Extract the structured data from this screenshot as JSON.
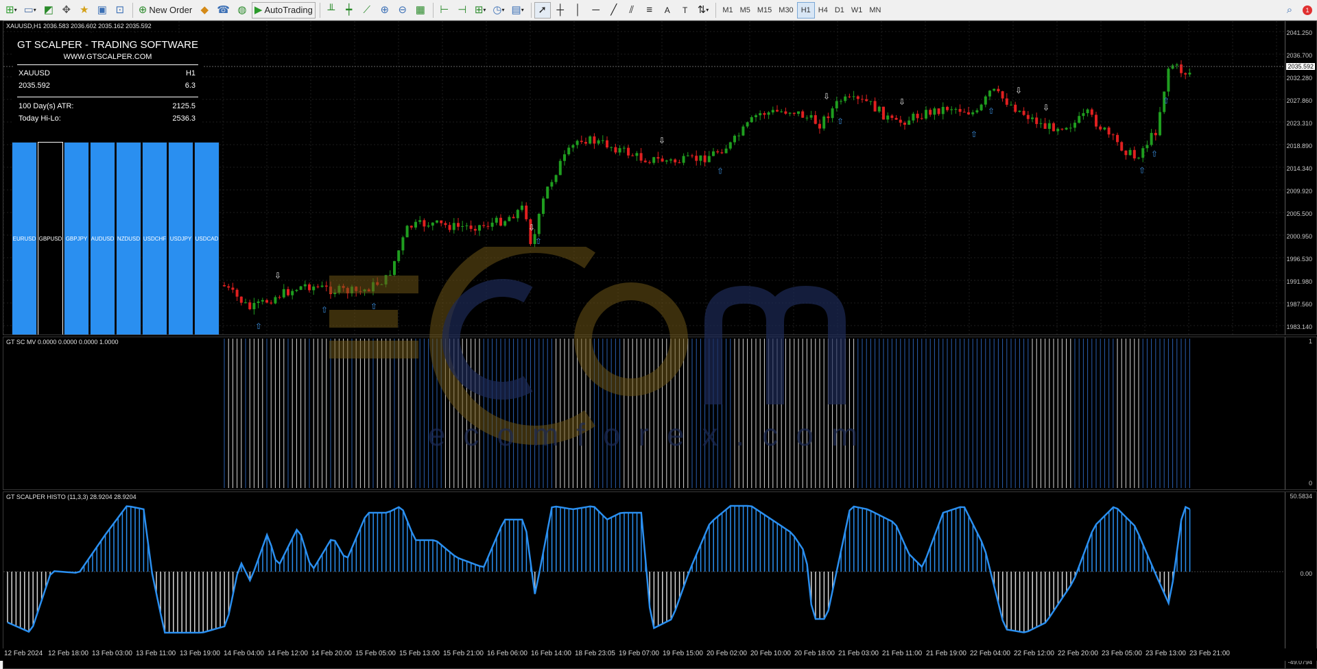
{
  "toolbar": {
    "new_order_label": "New Order",
    "autotrading_label": "AutoTrading",
    "timeframes": [
      "M1",
      "M5",
      "M15",
      "M30",
      "H1",
      "H4",
      "D1",
      "W1",
      "MN"
    ],
    "active_timeframe": "H1",
    "notification_count": "1"
  },
  "chart": {
    "header": "XAUUSD,H1  2036.583 2036.602 2035.162 2035.592",
    "current_price": "2035.592",
    "price_labels": [
      "2041.250",
      "2036.700",
      "2032.280",
      "2027.860",
      "2023.310",
      "2018.890",
      "2014.340",
      "2009.920",
      "2005.500",
      "2000.950",
      "1996.530",
      "1991.980",
      "1987.560",
      "1983.140"
    ],
    "bull_color": "#1f9d1f",
    "bear_color": "#e02020"
  },
  "info_panel": {
    "title": "GT SCALPER - TRADING SOFTWARE",
    "website": "WWW.GTSCALPER.COM",
    "symbol": "XAUUSD",
    "timeframe": "H1",
    "price": "2035.592",
    "spread": "6.3",
    "atr_label": "100 Day(s) ATR:",
    "atr_value": "2125.5",
    "hilo_label": "Today Hi-Lo:",
    "hilo_value": "2536.3"
  },
  "currency_buttons": [
    {
      "label": "EURUSD",
      "selected": false
    },
    {
      "label": "GBPUSD",
      "selected": true
    },
    {
      "label": "GBPJPY",
      "selected": false
    },
    {
      "label": "AUDUSD",
      "selected": false
    },
    {
      "label": "NZDUSD",
      "selected": false
    },
    {
      "label": "USDCHF",
      "selected": false
    },
    {
      "label": "USDJPY",
      "selected": false
    },
    {
      "label": "USDCAD",
      "selected": false
    }
  ],
  "indicator_mv": {
    "title": "GT SC MV 0.0000 0.0000 0.0000 1.0000",
    "axis_top": "1",
    "axis_bottom": "0"
  },
  "indicator_histo": {
    "title": "GT SCALPER HISTO (11,3,3) 28.9204 28.9204",
    "axis_top": "50.5834",
    "axis_mid": "0.00",
    "axis_bottom": "-49.0794"
  },
  "time_axis": [
    "12 Feb 2024",
    "12 Feb 18:00",
    "13 Feb 03:00",
    "13 Feb 11:00",
    "13 Feb 19:00",
    "14 Feb 04:00",
    "14 Feb 12:00",
    "14 Feb 20:00",
    "15 Feb 05:00",
    "15 Feb 13:00",
    "15 Feb 21:00",
    "16 Feb 06:00",
    "16 Feb 14:00",
    "18 Feb 23:05",
    "19 Feb 07:00",
    "19 Feb 15:00",
    "20 Feb 02:00",
    "20 Feb 10:00",
    "20 Feb 18:00",
    "21 Feb 03:00",
    "21 Feb 11:00",
    "21 Feb 19:00",
    "22 Feb 04:00",
    "22 Feb 12:00",
    "22 Feb 20:00",
    "23 Feb 05:00",
    "23 Feb 13:00",
    "23 Feb 21:00"
  ],
  "watermark": {
    "brand": "E c m",
    "domain": "ecomforex.com",
    "colors": {
      "gold": "#8a6a1a",
      "navy": "#1c2a55"
    }
  }
}
